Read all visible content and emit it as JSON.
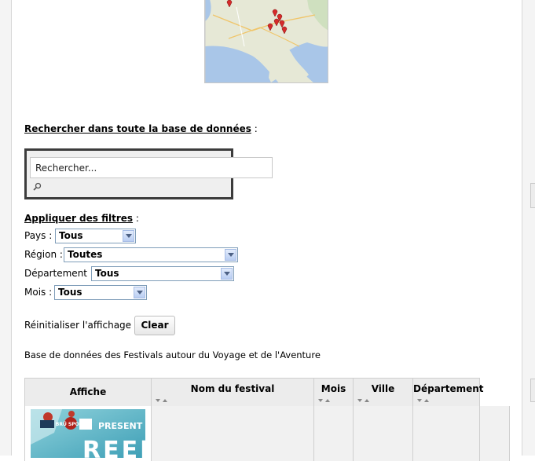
{
  "search": {
    "heading": "Rechercher dans toute la base de données",
    "heading_suffix": " :",
    "placeholder": "Rechercher..."
  },
  "filters": {
    "heading": "Appliquer des filtres",
    "heading_suffix": " :",
    "items": [
      {
        "label": "Pays :",
        "value": "Tous"
      },
      {
        "label": "Région :",
        "value": "Toutes"
      },
      {
        "label": "Département :",
        "value": "Tous"
      },
      {
        "label": "Mois :",
        "value": "Tous"
      }
    ]
  },
  "reset": {
    "label": "Réinitialiser l'affichage :",
    "button": "Clear"
  },
  "caption": "Base de données des Festivals autour du Voyage et de l'Aventure",
  "table": {
    "columns": [
      "Affiche",
      "Nom du festival",
      "Mois",
      "Ville",
      "Département"
    ]
  },
  "poster_text": {
    "badge": "BRÜ SPORT",
    "present": "PRESENT",
    "title": "REEL"
  },
  "colors": {
    "map_water": "#a9c6e8",
    "map_land": "#e6e8d6",
    "marker": "#d62a2a",
    "select_border": "#7f9db9"
  }
}
